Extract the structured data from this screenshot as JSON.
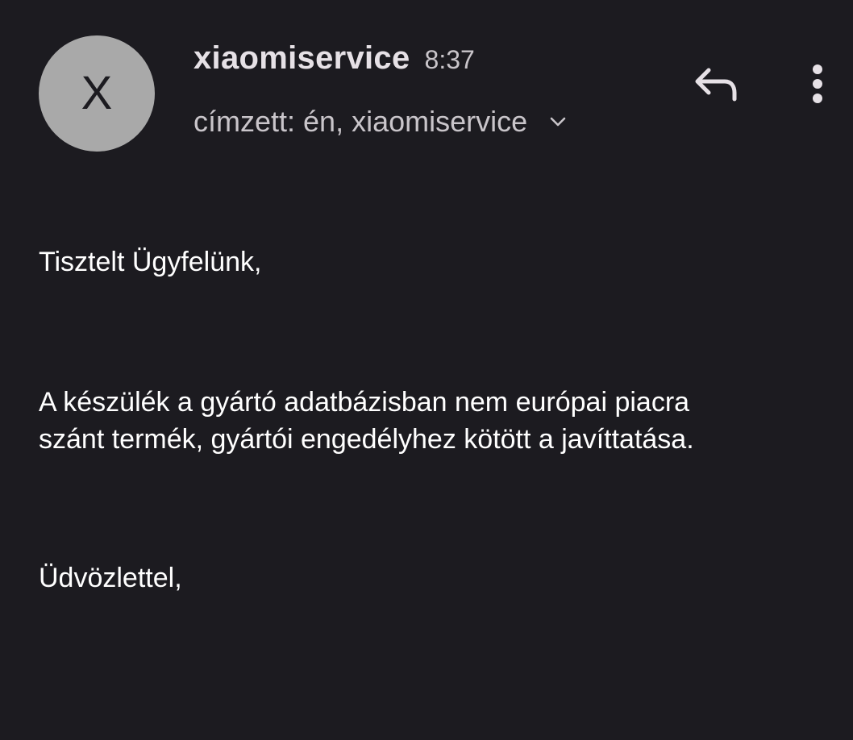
{
  "sender": {
    "avatar_letter": "X",
    "name": "xiaomiservice",
    "time": "8:37"
  },
  "recipients": {
    "text": "címzett: én, xiaomiservice"
  },
  "actions": {
    "reply_icon": "reply-icon",
    "more_icon": "more-vert-icon",
    "expand_icon": "chevron-down-icon"
  },
  "message": {
    "greeting": "Tisztelt Ügyfelünk,",
    "paragraph_line1": "A készülék a gyártó adatbázisban nem európai piacra",
    "paragraph_line2": "szánt termék, gyártói engedélyhez kötött a javíttatása.",
    "closing": "Üdvözlettel,"
  },
  "colors": {
    "background": "#1c1b20",
    "avatar": "#a9a9a9",
    "secondary_text": "#c9c5ca",
    "primary_text": "#ffffff"
  }
}
